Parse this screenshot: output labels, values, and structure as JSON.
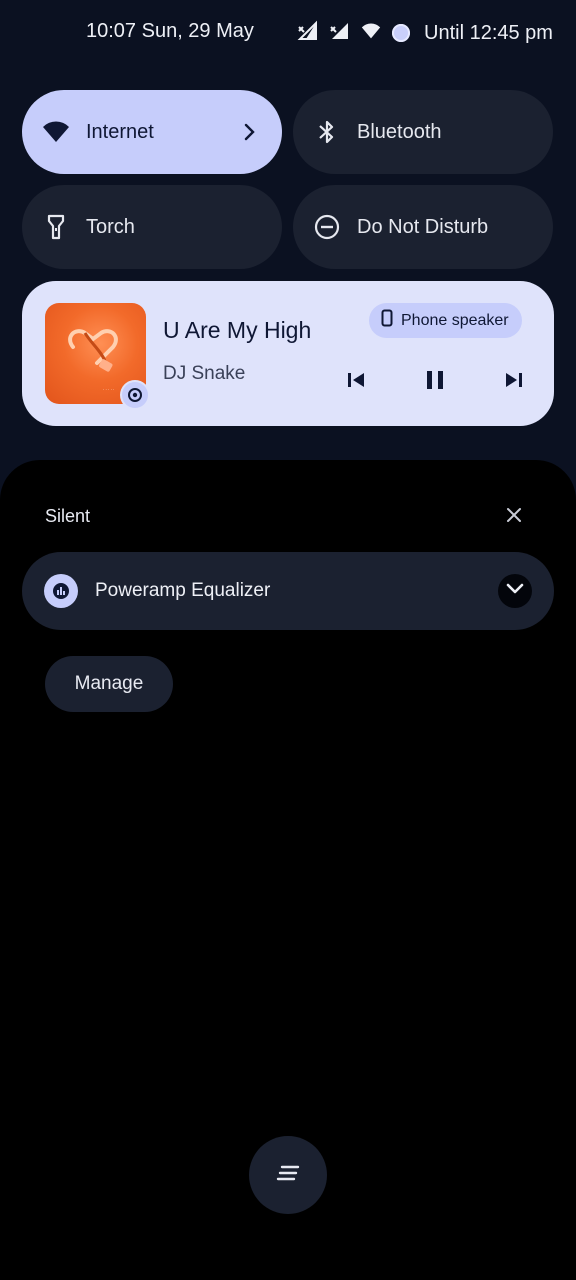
{
  "status_bar": {
    "datetime": "10:07 Sun, 29 May",
    "alarm_text": "Until 12:45 pm",
    "icons": [
      "signal-icon",
      "signal-icon",
      "wifi-icon",
      "dnd-status-icon"
    ]
  },
  "quick_settings": {
    "tiles": [
      {
        "label": "Internet",
        "icon": "wifi-icon",
        "active": true
      },
      {
        "label": "Bluetooth",
        "icon": "bluetooth-icon",
        "active": false
      },
      {
        "label": "Torch",
        "icon": "torch-icon",
        "active": false
      },
      {
        "label": "Do Not Disturb",
        "icon": "do-not-disturb-icon",
        "active": false
      }
    ]
  },
  "media_player": {
    "title": "U Are My High",
    "artist": "DJ Snake",
    "output_device": "Phone speaker",
    "controls": [
      "previous-icon",
      "pause-icon",
      "next-icon"
    ]
  },
  "notifications": {
    "section_title": "Silent",
    "items": [
      {
        "title": "Poweramp Equalizer",
        "icon": "equalizer-icon"
      }
    ],
    "manage_label": "Manage"
  },
  "colors": {
    "background": "#0b1121",
    "accent": "#c6cdfb",
    "tile_off": "#1b2130",
    "media_card": "#dfe3fb",
    "shade": "#000000"
  }
}
